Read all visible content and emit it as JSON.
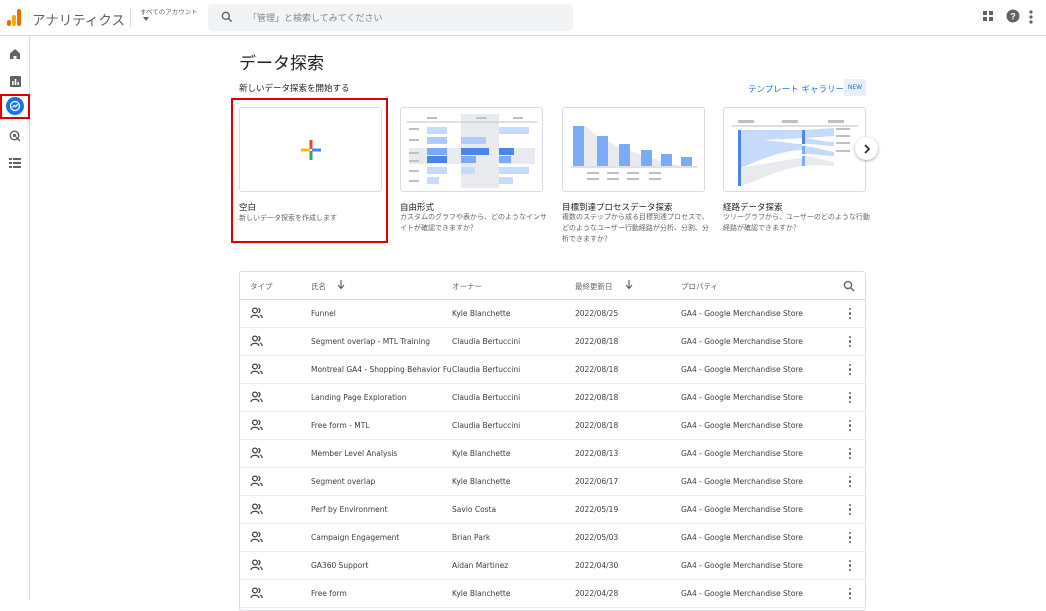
{
  "app": {
    "title": "アナリティクス",
    "account_label": "すべてのアカウント",
    "search_placeholder": "「管理」と検索してみてください"
  },
  "colors": {
    "accent": "#1a73e8",
    "highlight": "#e00000"
  },
  "page": {
    "title": "データ探索",
    "section_label": "新しいデータ探索を開始する",
    "gallery_link": "テンプレート ギャラリー",
    "new_badge": "NEW"
  },
  "templates": [
    {
      "name": "空白",
      "desc": "新しいデータ探索を作成します"
    },
    {
      "name": "自由形式",
      "desc": "カスタムのグラフや表から、どのようなインサイトが確認できますか？"
    },
    {
      "name": "目標到達プロセスデータ探索",
      "desc": "複数のステップから成る目標到達プロセスで、どのようなユーザー行動経路が分析、分割、分析できますか？"
    },
    {
      "name": "経路データ探索",
      "desc": "ツリーグラフから、ユーザーのどのような行動経路が確認できますか？"
    }
  ],
  "table": {
    "headers": [
      "タイプ",
      "氏名",
      "オーナー",
      "最終更新日",
      "プロパティ"
    ],
    "rows": [
      {
        "name": "Funnel",
        "owner": "Kyle Blanchette",
        "date": "2022/08/25",
        "property": "GA4 - Google Merchandise Store"
      },
      {
        "name": "Segment overlap - MTL Training",
        "owner": "Claudia Bertuccini",
        "date": "2022/08/18",
        "property": "GA4 - Google Merchandise Store"
      },
      {
        "name": "Montreal GA4 - Shopping Behavior Fu...",
        "owner": "Claudia Bertuccini",
        "date": "2022/08/18",
        "property": "GA4 - Google Merchandise Store"
      },
      {
        "name": "Landing Page Exploration",
        "owner": "Claudia Bertuccini",
        "date": "2022/08/18",
        "property": "GA4 - Google Merchandise Store"
      },
      {
        "name": "Free form - MTL",
        "owner": "Claudia Bertuccini",
        "date": "2022/08/18",
        "property": "GA4 - Google Merchandise Store"
      },
      {
        "name": "Member Level Analysis",
        "owner": "Kyle Blanchette",
        "date": "2022/08/13",
        "property": "GA4 - Google Merchandise Store"
      },
      {
        "name": "Segment overlap",
        "owner": "Kyle Blanchette",
        "date": "2022/06/17",
        "property": "GA4 - Google Merchandise Store"
      },
      {
        "name": "Perf by Environment",
        "owner": "Savio Costa",
        "date": "2022/05/19",
        "property": "GA4 - Google Merchandise Store"
      },
      {
        "name": "Campaign Engagement",
        "owner": "Brian Park",
        "date": "2022/05/03",
        "property": "GA4 - Google Merchandise Store"
      },
      {
        "name": "GA360 Support",
        "owner": "Aidan Martinez",
        "date": "2022/04/30",
        "property": "GA4 - Google Merchandise Store"
      },
      {
        "name": "Free form",
        "owner": "Kyle Blanchette",
        "date": "2022/04/28",
        "property": "GA4 - Google Merchandise Store"
      }
    ]
  }
}
